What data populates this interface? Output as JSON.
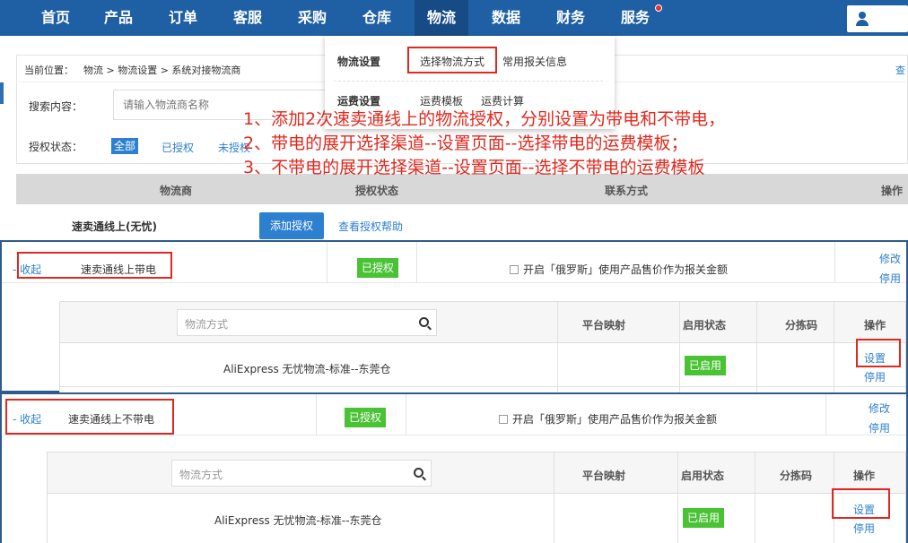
{
  "nav": {
    "items": [
      "首页",
      "产品",
      "订单",
      "客服",
      "采购",
      "仓库",
      "物流",
      "数据",
      "财务",
      "服务"
    ],
    "active": "物流"
  },
  "breadcrumb": {
    "label": "当前位置：",
    "path": "物流 > 物流设置 > 系统对接物流商",
    "right_link": "查"
  },
  "dropdown": {
    "logistics_settings": "物流设置",
    "choose_method": "选择物流方式",
    "customs_info": "常用报关信息",
    "freight_settings": "运费设置",
    "freight_template": "运费模板",
    "freight_calc": "运费计算"
  },
  "filters": {
    "search_label": "搜索内容：",
    "search_placeholder": "请输入物流商名称",
    "auth_label": "授权状态：",
    "all": "全部",
    "authorized": "已授权",
    "unauthorized": "未授权"
  },
  "annotation": {
    "line1": "1、添加2次速卖通线上的物流授权，分别设置为带电和不带电，",
    "line2": "2、带电的展开选择渠道--设置页面--选择带电的运费模板；",
    "line3": "3、不带电的展开选择渠道--设置页面--选择不带电的运费模板"
  },
  "table_header": {
    "provider": "物流商",
    "auth_status": "授权状态",
    "contact": "联系方式",
    "action": "操作"
  },
  "provider_row": {
    "name": "速卖通线上(无忧)",
    "add_auth": "添加授权",
    "help": "查看授权帮助"
  },
  "sections": [
    {
      "collapse": "- 收起",
      "name": "速卖通线上带电",
      "status": "已授权",
      "customs_text": "开启「俄罗斯」使用产品售价作为报关金额",
      "edit": "修改",
      "disable": "停用",
      "search_placeholder": "物流方式",
      "th_mapping": "平台映射",
      "th_enabled": "启用状态",
      "th_sort": "分拣码",
      "th_action": "操作",
      "method": "AliExpress 无忧物流-标准--东莞仓",
      "enabled": "已启用",
      "set": "设置",
      "stop": "停用"
    },
    {
      "collapse": "- 收起",
      "name": "速卖通线上不带电",
      "status": "已授权",
      "customs_text": "开启「俄罗斯」使用产品售价作为报关金额",
      "edit": "修改",
      "disable": "停用",
      "search_placeholder": "物流方式",
      "th_mapping": "平台映射",
      "th_enabled": "启用状态",
      "th_sort": "分拣码",
      "th_action": "操作",
      "method": "AliExpress 无忧物流-标准--东莞仓",
      "enabled": "已启用",
      "set": "设置",
      "stop": "停用"
    }
  ],
  "colors": {
    "nav_bg": "#1f5fa3",
    "accent": "#2d7fd0",
    "green": "#49c234",
    "annotation_red": "#e0281e"
  }
}
